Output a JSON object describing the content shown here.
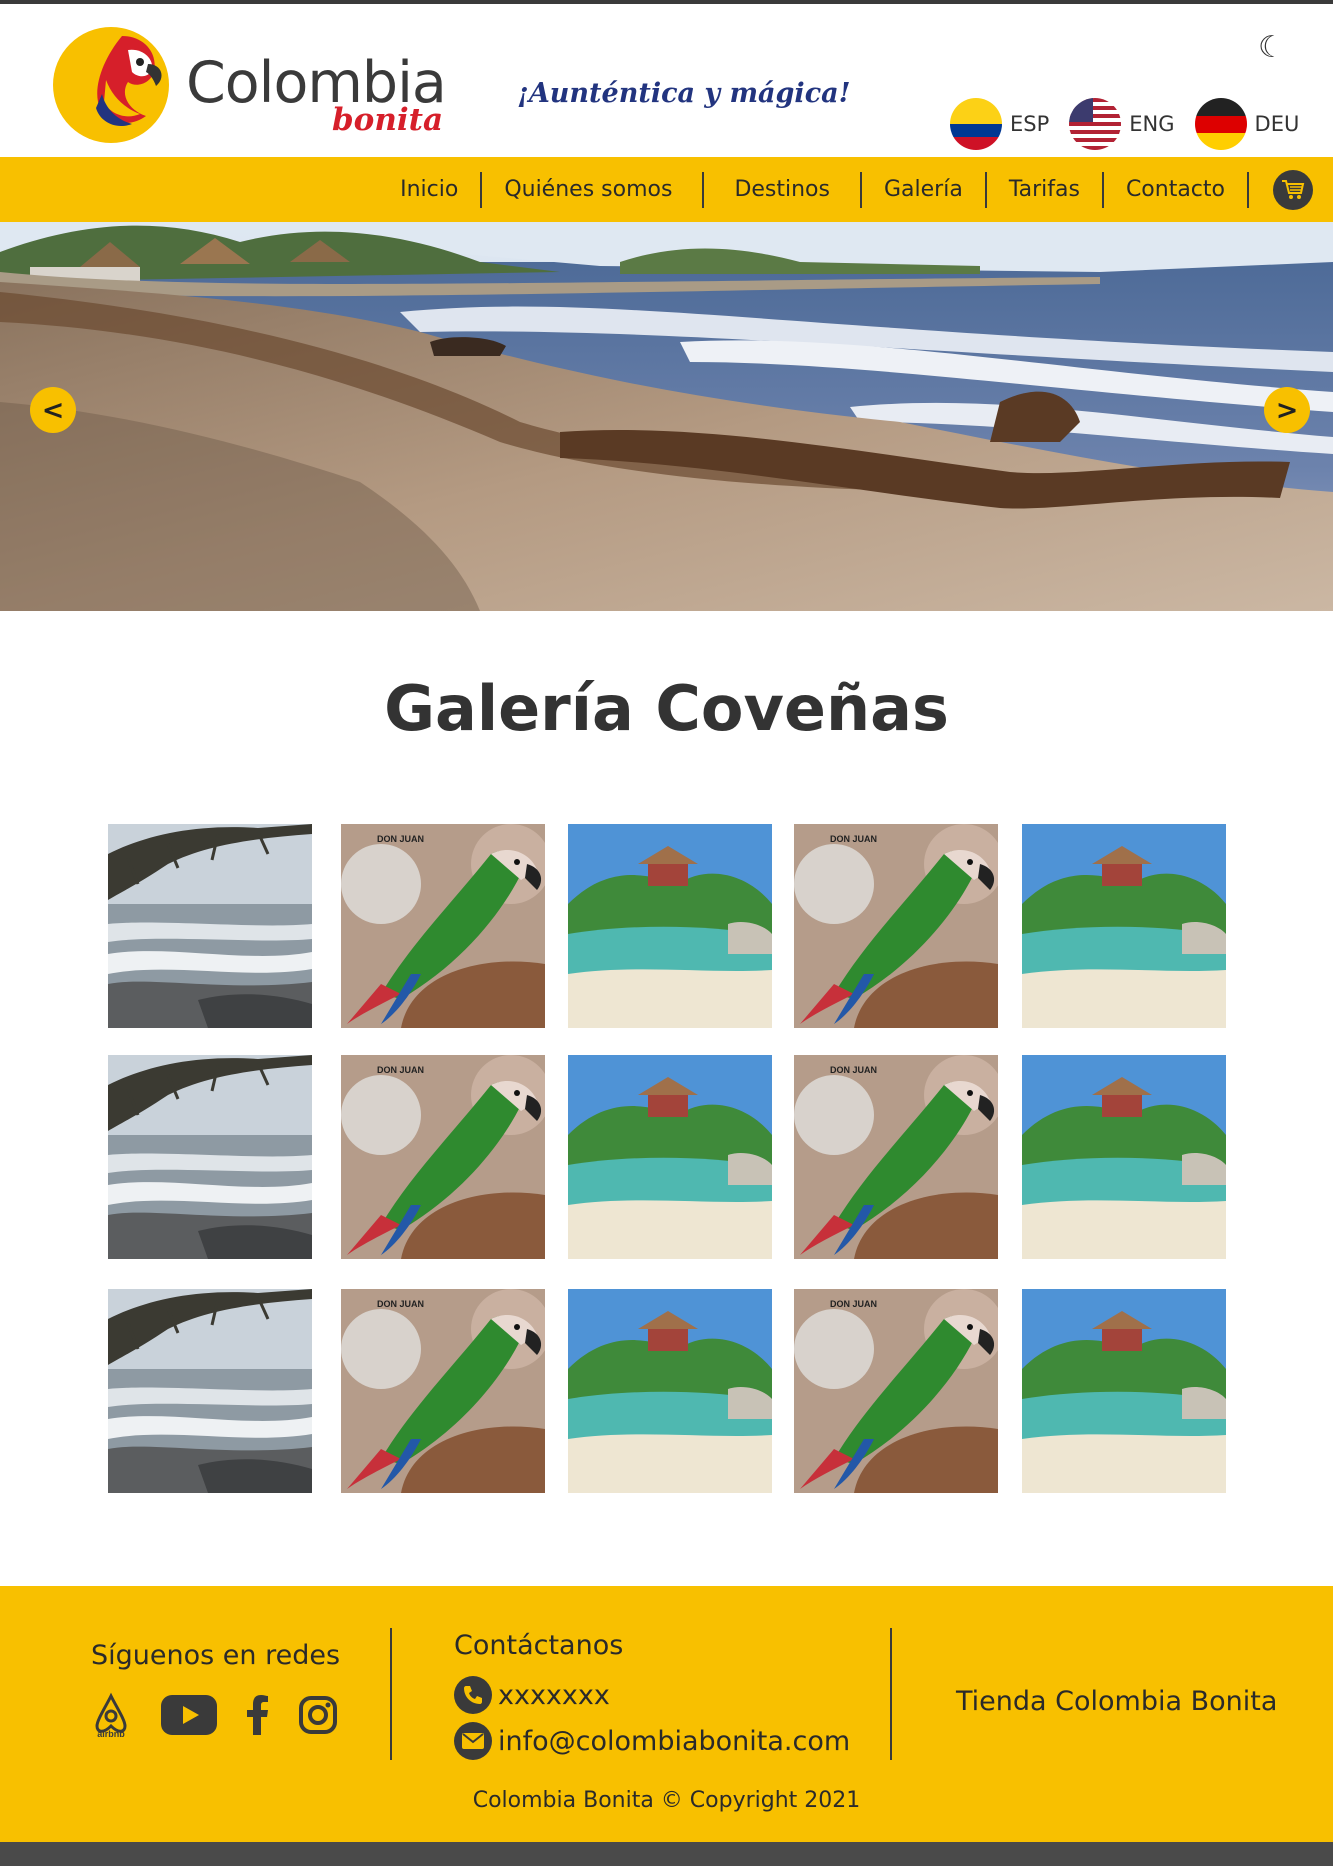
{
  "header": {
    "logo_word": "Colombia",
    "logo_sub": "bonita",
    "tagline": "¡Aunténtica y mágica!",
    "theme_toggle_icon": "moon-icon",
    "languages": [
      {
        "code": "ESP",
        "flag": "colombia-flag-icon"
      },
      {
        "code": "ENG",
        "flag": "usa-flag-icon"
      },
      {
        "code": "DEU",
        "flag": "germany-flag-icon"
      }
    ]
  },
  "nav": {
    "items": [
      "Inicio",
      "Quiénes somos",
      "Destinos",
      "Galería",
      "Tarifas",
      "Contacto"
    ],
    "cart_icon": "cart-icon"
  },
  "hero": {
    "prev": "<",
    "next": ">"
  },
  "gallery": {
    "title": "Galería Coveñas",
    "rows": [
      [
        "beach-waves-photo",
        "macaw-photo",
        "island-cove-photo",
        "macaw-photo",
        "island-cove-photo"
      ],
      [
        "beach-waves-photo",
        "macaw-photo",
        "island-cove-photo",
        "macaw-photo",
        "island-cove-photo"
      ],
      [
        "beach-waves-photo",
        "macaw-photo",
        "island-cove-photo",
        "macaw-photo",
        "island-cove-photo"
      ]
    ],
    "photo_caption": "DON JUAN"
  },
  "footer": {
    "social_title": "Síguenos en redes",
    "socials": [
      "airbnb-icon",
      "youtube-icon",
      "facebook-icon",
      "instagram-icon"
    ],
    "airbnb_label": "airbnb",
    "contact_title": "Contáctanos",
    "phone": "xxxxxxx",
    "email": "info@colombiabonita.com",
    "store": "Tienda Colombia Bonita",
    "copyright": "Colombia Bonita © Copyright 2021"
  },
  "colors": {
    "accent": "#f8c000",
    "dark": "#3a3a3a",
    "tagline": "#22347f",
    "brand_red": "#d61f2a"
  }
}
